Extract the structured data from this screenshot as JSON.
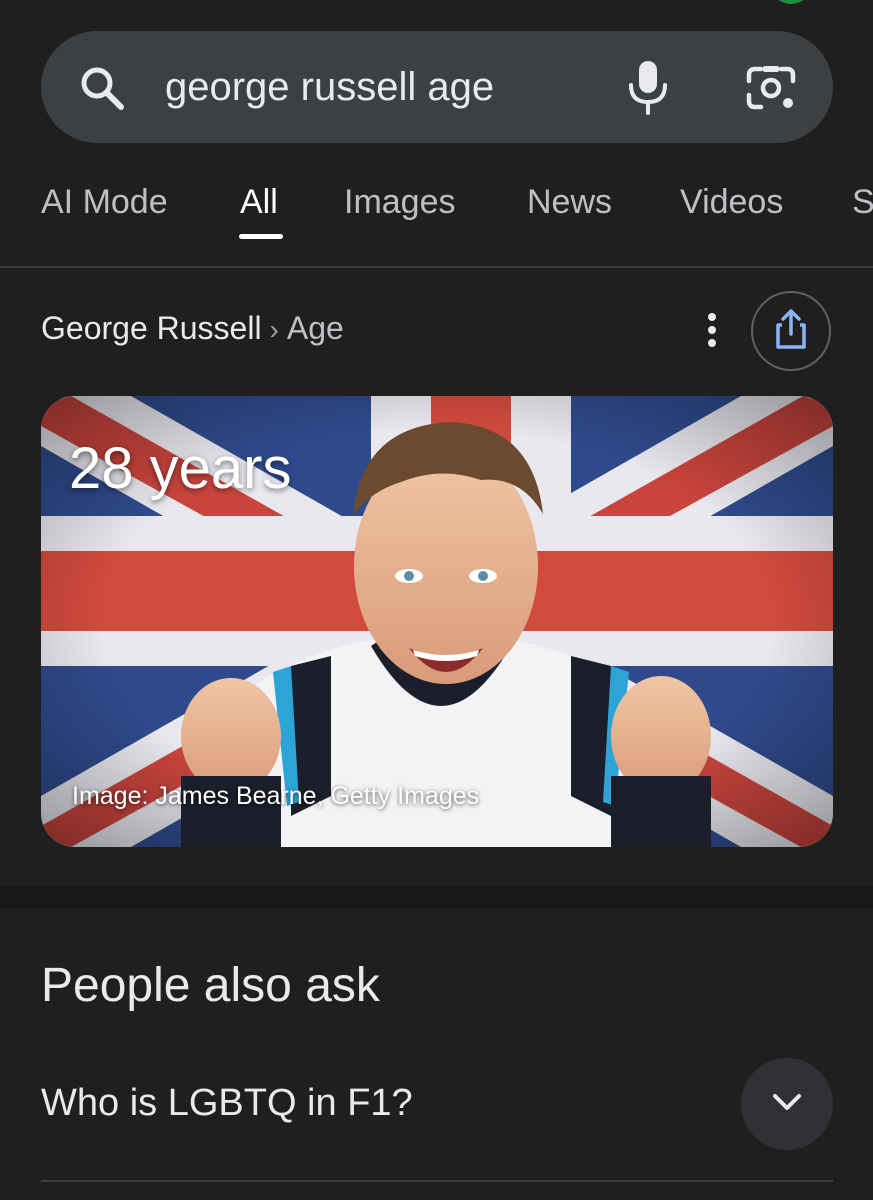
{
  "search": {
    "query": "george russell age"
  },
  "tabs": [
    {
      "label": "AI Mode",
      "active": false
    },
    {
      "label": "All",
      "active": true
    },
    {
      "label": "Images",
      "active": false
    },
    {
      "label": "News",
      "active": false
    },
    {
      "label": "Videos",
      "active": false
    },
    {
      "label": "S",
      "active": false
    }
  ],
  "breadcrumb": {
    "entity": "George Russell",
    "separator": "›",
    "attribute": "Age"
  },
  "answer": {
    "value": "28 years",
    "image_credit": "Image: James Bearne, Getty Images"
  },
  "people_also_ask": {
    "title": "People also ask",
    "questions": [
      "Who is LGBTQ in F1?"
    ]
  },
  "icons": {
    "search": "search-icon",
    "mic": "microphone-icon",
    "lens": "camera-lens-icon",
    "more": "more-vertical-icon",
    "share": "share-icon",
    "expand": "chevron-down-icon"
  },
  "colors": {
    "background": "#1f1f1f",
    "search_bar": "#3c4043",
    "link_blue": "#8ab4f8",
    "text_primary": "#e8eaed",
    "text_secondary": "#bdc1c6"
  }
}
